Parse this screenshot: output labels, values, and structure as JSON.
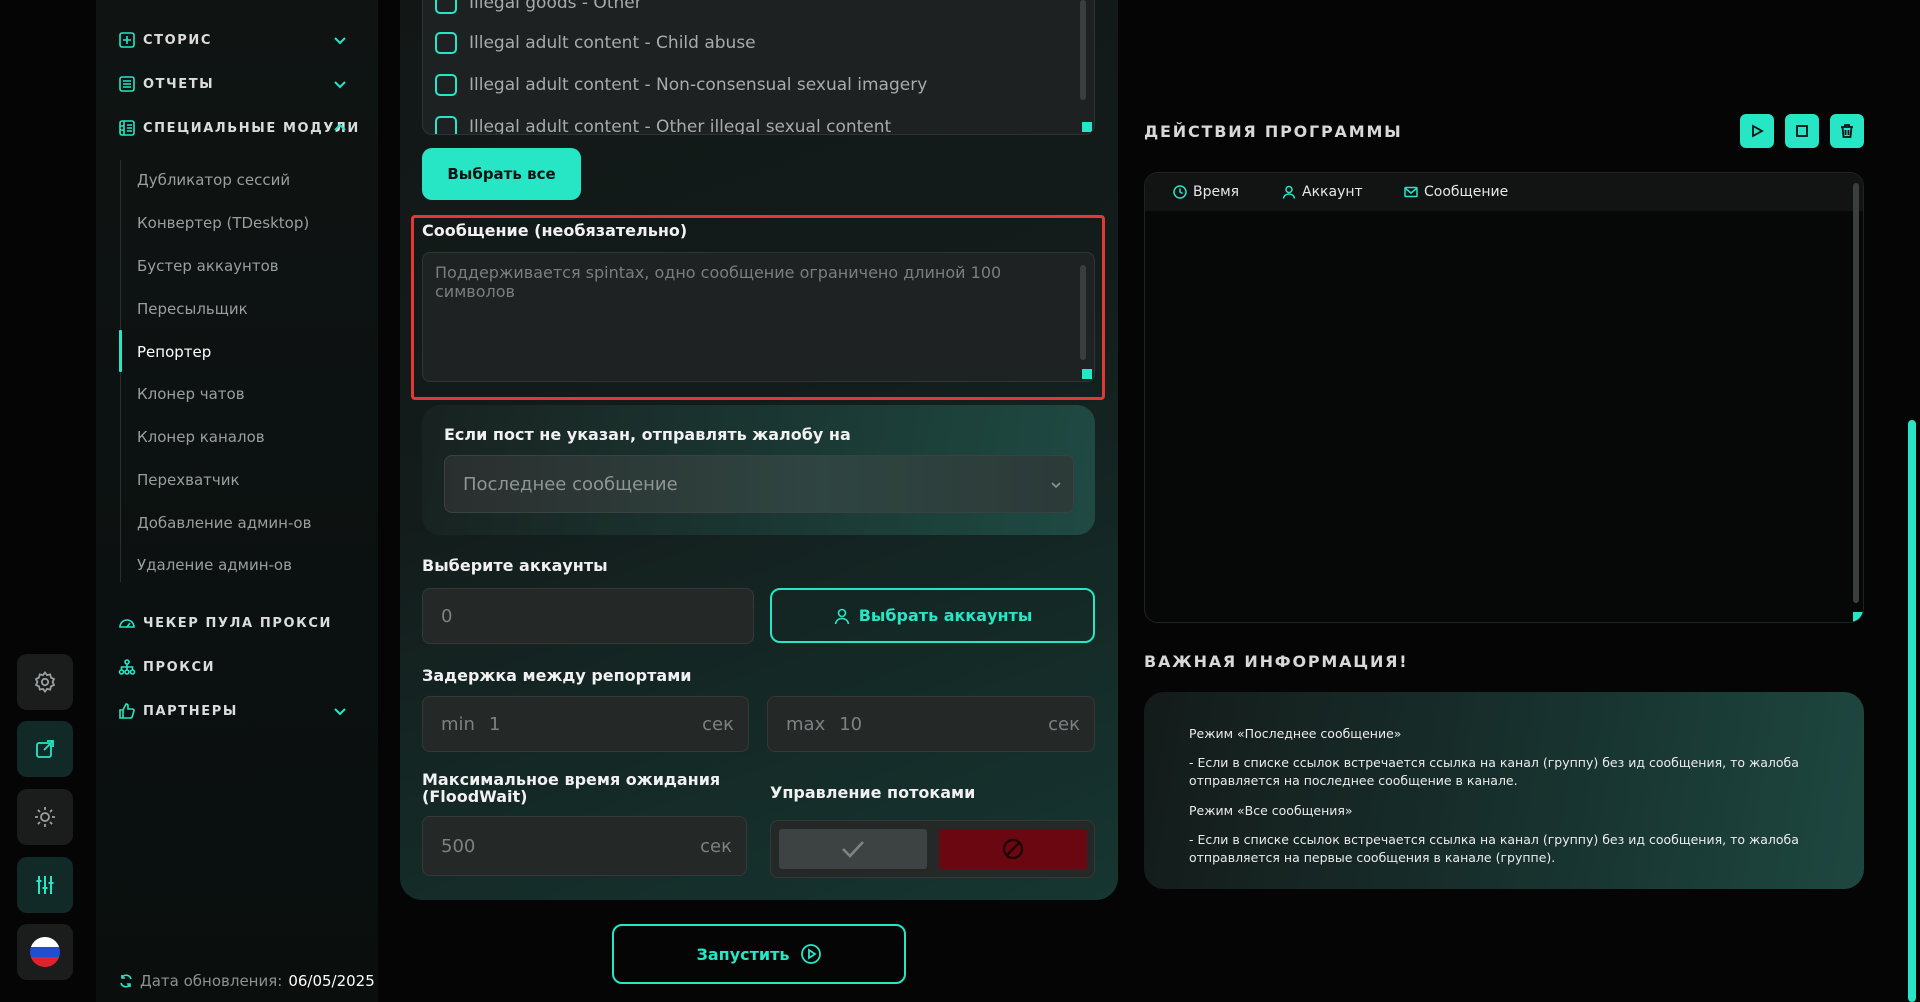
{
  "sidebar": {
    "sections": [
      {
        "label": "СТОРИС"
      },
      {
        "label": "ОТЧЕТЫ"
      },
      {
        "label": "СПЕЦИАЛЬНЫЕ МОДУЛИ"
      },
      {
        "label": "ЧЕКЕР ПУЛА ПРОКСИ"
      },
      {
        "label": "ПРОКСИ"
      },
      {
        "label": "ПАРТНЕРЫ"
      }
    ],
    "special_items": [
      "Дубликатор сессий",
      "Конвертер (TDesktop)",
      "Бустер аккаунтов",
      "Пересыльщик",
      "Репортер",
      "Клонер чатов",
      "Клонер каналов",
      "Перехватчик",
      "Добавление админ-ов",
      "Удаление админ-ов"
    ],
    "active_item": "Репортер",
    "update_label": "Дата обновления:",
    "update_date": "06/05/2025"
  },
  "rail": {
    "icons": [
      "gear-icon",
      "external-link-icon",
      "sun-icon",
      "sliders-icon",
      "russia-flag-icon"
    ]
  },
  "form": {
    "categories": [
      "Illegal goods - Other",
      "Illegal adult content - Child abuse",
      "Illegal adult content - Non-consensual sexual imagery",
      "Illegal adult content - Other illegal sexual content"
    ],
    "select_all_label": "Выбрать все",
    "message_label": "Сообщение (необязательно)",
    "message_placeholder": "Поддерживается spintax, одно сообщение ограничено длиной 100 символов",
    "fallback_label": "Если пост не указан, отправлять жалобу на",
    "fallback_value": "Последнее сообщение",
    "accounts_label": "Выберите аккаунты",
    "accounts_count": "0",
    "select_accounts_label": "Выбрать аккаунты",
    "delay_label": "Задержка между репортами",
    "delay_min_label": "min",
    "delay_min_value": "1",
    "delay_max_label": "max",
    "delay_max_value": "10",
    "unit_sec": "сек",
    "floodwait_label": "Максимальное время ожидания (FloodWait)",
    "floodwait_value": "500",
    "threads_label": "Управление потоками",
    "run_label": "Запустить"
  },
  "actions": {
    "title": "ДЕЙСТВИЯ ПРОГРАММЫ",
    "columns": [
      "Время",
      "Аккаунт",
      "Сообщение"
    ]
  },
  "info": {
    "title": "ВАЖНАЯ ИНФОРМАЦИЯ!",
    "lines": [
      "Режим «Последнее сообщение»",
      "- Если в списке ссылок встречается ссылка на канал (группу) без ид сообщения, то жалоба отправляется на последнее сообщение в канале.",
      "Режим «Все сообщения»",
      "- Если в списке ссылок встречается ссылка на канал (группу) без ид сообщения, то жалоба отправляется на первые сообщения в канале (группе)."
    ]
  },
  "colors": {
    "accent": "#26e6c6",
    "highlight_border": "#e23a32",
    "stop_button": "#6b0710"
  }
}
